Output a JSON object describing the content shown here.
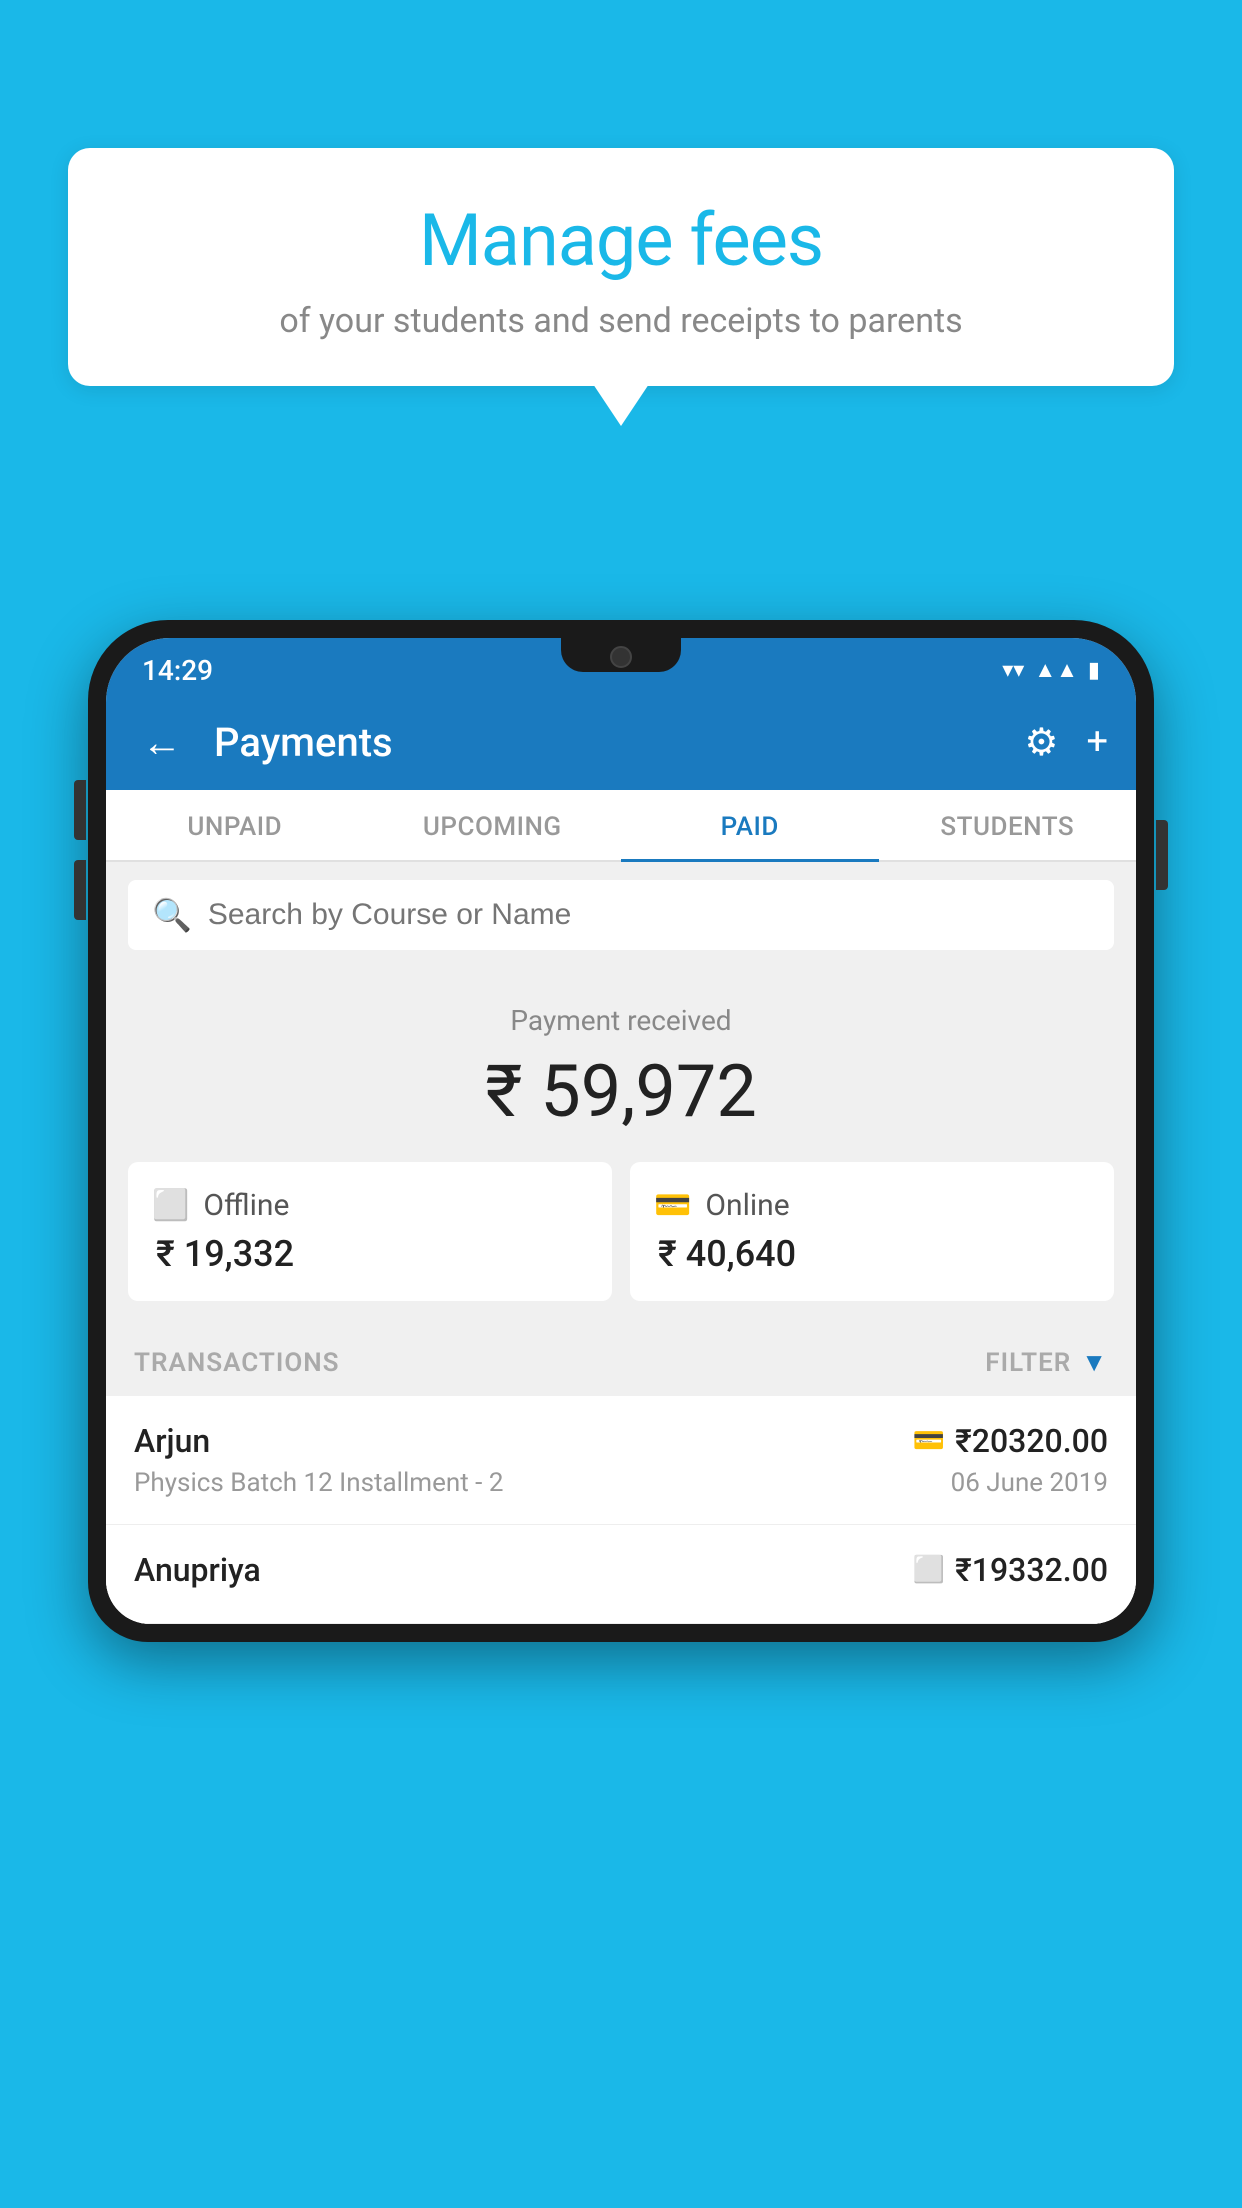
{
  "background_color": "#1ab8e8",
  "speech_bubble": {
    "title": "Manage fees",
    "subtitle": "of your students and send receipts to parents"
  },
  "phone": {
    "status_bar": {
      "time": "14:29",
      "icons": [
        "wifi",
        "signal",
        "battery"
      ]
    },
    "header": {
      "back_label": "←",
      "title": "Payments",
      "gear_icon": "⚙",
      "plus_icon": "+"
    },
    "tabs": [
      {
        "label": "UNPAID",
        "active": false
      },
      {
        "label": "UPCOMING",
        "active": false
      },
      {
        "label": "PAID",
        "active": true
      },
      {
        "label": "STUDENTS",
        "active": false
      }
    ],
    "search": {
      "placeholder": "Search by Course or Name"
    },
    "payment_summary": {
      "label": "Payment received",
      "amount": "₹ 59,972",
      "offline": {
        "type": "Offline",
        "amount": "₹ 19,332"
      },
      "online": {
        "type": "Online",
        "amount": "₹ 40,640"
      }
    },
    "transactions_section": {
      "label": "TRANSACTIONS",
      "filter_label": "FILTER"
    },
    "transactions": [
      {
        "name": "Arjun",
        "course": "Physics Batch 12 Installment - 2",
        "amount": "₹20320.00",
        "date": "06 June 2019",
        "payment_type": "online"
      },
      {
        "name": "Anupriya",
        "course": "",
        "amount": "₹19332.00",
        "date": "",
        "payment_type": "offline"
      }
    ]
  }
}
